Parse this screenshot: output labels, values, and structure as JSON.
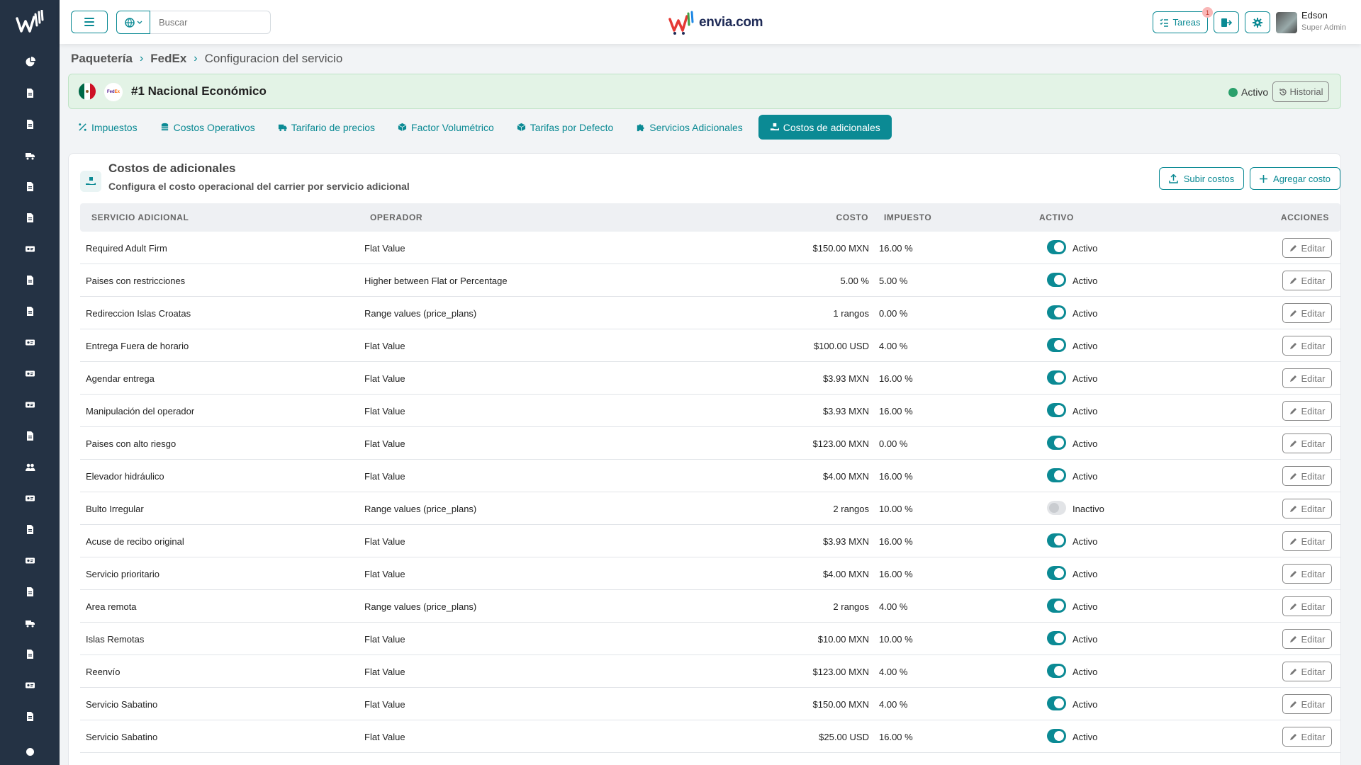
{
  "header": {
    "search_placeholder": "Buscar",
    "brand": "envia.com",
    "tasks_label": "Tareas",
    "tasks_badge": "1",
    "user_name": "Edson",
    "user_role": "Super Admin"
  },
  "breadcrumb": {
    "item1": "Paquetería",
    "item2": "FedEx",
    "current": "Configuracion del servicio"
  },
  "service": {
    "carrier": "FedEx",
    "title": "#1 Nacional Económico",
    "status": "Activo",
    "history_label": "Historial"
  },
  "tabs": [
    {
      "label": "Impuestos",
      "icon": "percent-icon"
    },
    {
      "label": "Costos Operativos",
      "icon": "coins-icon"
    },
    {
      "label": "Tarifario de precios",
      "icon": "truck-icon"
    },
    {
      "label": "Factor Volumétrico",
      "icon": "box-icon"
    },
    {
      "label": "Tarifas por Defecto",
      "icon": "box-icon"
    },
    {
      "label": "Servicios Adicionales",
      "icon": "puzzle-icon"
    },
    {
      "label": "Costos de adicionales",
      "icon": "hand-box-icon"
    }
  ],
  "card": {
    "title": "Costos de adicionales",
    "subtitle": "Configura el costo operacional del carrier por servicio adicional",
    "upload_label": "Subir costos",
    "add_label": "Agregar costo"
  },
  "table": {
    "headers": {
      "service": "SERVICIO ADICIONAL",
      "operator": "OPERADOR",
      "cost": "COSTO",
      "tax": "IMPUESTO",
      "active": "ACTIVO",
      "actions": "ACCIONES"
    },
    "edit_label": "Editar",
    "rows": [
      {
        "service": "Required Adult Firm",
        "operator": "Flat Value",
        "cost": "$150.00 MXN",
        "tax": "16.00 %",
        "active": true,
        "state": "Activo"
      },
      {
        "service": "Paises con restricciones",
        "operator": "Higher between Flat or Percentage",
        "cost": "5.00 %",
        "tax": "5.00 %",
        "active": true,
        "state": "Activo"
      },
      {
        "service": "Redireccion Islas Croatas",
        "operator": "Range values (price_plans)",
        "cost": "1 rangos",
        "tax": "0.00 %",
        "active": true,
        "state": "Activo"
      },
      {
        "service": "Entrega Fuera de horario",
        "operator": "Flat Value",
        "cost": "$100.00 USD",
        "tax": "4.00 %",
        "active": true,
        "state": "Activo"
      },
      {
        "service": "Agendar entrega",
        "operator": "Flat Value",
        "cost": "$3.93 MXN",
        "tax": "16.00 %",
        "active": true,
        "state": "Activo"
      },
      {
        "service": "Manipulación del operador",
        "operator": "Flat Value",
        "cost": "$3.93 MXN",
        "tax": "16.00 %",
        "active": true,
        "state": "Activo"
      },
      {
        "service": "Paises con alto riesgo",
        "operator": "Flat Value",
        "cost": "$123.00 MXN",
        "tax": "0.00 %",
        "active": true,
        "state": "Activo"
      },
      {
        "service": "Elevador hidráulico",
        "operator": "Flat Value",
        "cost": "$4.00 MXN",
        "tax": "16.00 %",
        "active": true,
        "state": "Activo"
      },
      {
        "service": "Bulto Irregular",
        "operator": "Range values (price_plans)",
        "cost": "2 rangos",
        "tax": "10.00 %",
        "active": false,
        "state": "Inactivo"
      },
      {
        "service": "Acuse de recibo original",
        "operator": "Flat Value",
        "cost": "$3.93 MXN",
        "tax": "16.00 %",
        "active": true,
        "state": "Activo"
      },
      {
        "service": "Servicio prioritario",
        "operator": "Flat Value",
        "cost": "$4.00 MXN",
        "tax": "16.00 %",
        "active": true,
        "state": "Activo"
      },
      {
        "service": "Area remota",
        "operator": "Range values (price_plans)",
        "cost": "2 rangos",
        "tax": "4.00 %",
        "active": true,
        "state": "Activo"
      },
      {
        "service": "Islas Remotas",
        "operator": "Flat Value",
        "cost": "$10.00 MXN",
        "tax": "10.00 %",
        "active": true,
        "state": "Activo"
      },
      {
        "service": "Reenvío",
        "operator": "Flat Value",
        "cost": "$123.00 MXN",
        "tax": "4.00 %",
        "active": true,
        "state": "Activo"
      },
      {
        "service": "Servicio Sabatino",
        "operator": "Flat Value",
        "cost": "$150.00 MXN",
        "tax": "4.00 %",
        "active": true,
        "state": "Activo"
      },
      {
        "service": "Servicio Sabatino",
        "operator": "Flat Value",
        "cost": "$25.00 USD",
        "tax": "16.00 %",
        "active": true,
        "state": "Activo"
      }
    ]
  },
  "sidebar": {
    "icons": [
      "chart-pie-icon",
      "clipboard-icon",
      "box-x-icon",
      "truck-icon",
      "calendar-icon",
      "bag-icon",
      "money-icon",
      "file-icon",
      "file-icon",
      "id-card-icon",
      "money-icon",
      "id-card-icon",
      "store-icon",
      "users-icon",
      "id-card-icon",
      "file-signature-icon",
      "list-icon",
      "file-icon",
      "truck-icon",
      "file-icon",
      "list-icon",
      "file-icon",
      "circle-icon"
    ]
  },
  "colors": {
    "accent": "#0b8a94",
    "sidebar": "#243244",
    "active_green": "#2aa06b"
  }
}
